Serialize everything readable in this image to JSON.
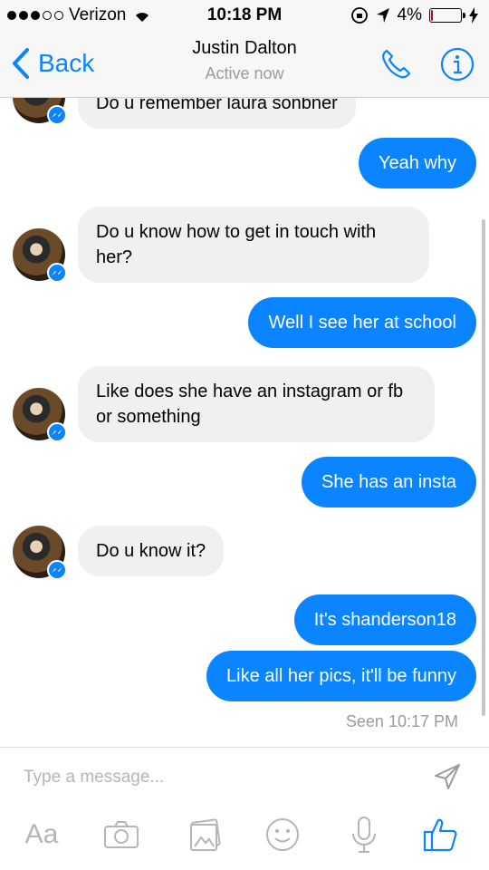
{
  "status_bar": {
    "carrier": "Verizon",
    "time": "10:18 PM",
    "battery_percent": "4%",
    "battery_level": 0.04,
    "battery_color": "#d0021b"
  },
  "nav": {
    "back_label": "Back",
    "contact_name": "Justin Dalton",
    "status": "Active now"
  },
  "messages": [
    {
      "direction": "in",
      "text": "Do u remember laura sonbner"
    },
    {
      "direction": "out",
      "text": "Yeah why"
    },
    {
      "direction": "in",
      "text": "Do u know how to get in touch with her?"
    },
    {
      "direction": "out",
      "text": "Well I see her at school"
    },
    {
      "direction": "in",
      "text": "Like does she have an instagram  or fb or something"
    },
    {
      "direction": "out",
      "text": "She has an insta"
    },
    {
      "direction": "in",
      "text": "Do u know it?"
    },
    {
      "direction": "out",
      "text": "It's shanderson18"
    },
    {
      "direction": "out",
      "text": "Like all her pics, it'll be funny"
    }
  ],
  "seen": "Seen 10:17 PM",
  "compose": {
    "placeholder": "Type a message...",
    "aa_label": "Aa"
  },
  "colors": {
    "accent": "#0a84ff",
    "incoming_bubble": "#f1f0f0"
  },
  "icons": [
    "back-chevron-icon",
    "phone-icon",
    "info-icon",
    "send-icon",
    "camera-icon",
    "photo-icon",
    "emoji-icon",
    "microphone-icon",
    "like-icon"
  ]
}
